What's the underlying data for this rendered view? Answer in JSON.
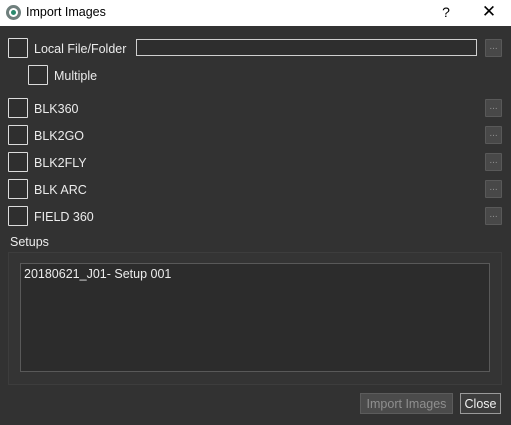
{
  "window": {
    "title": "Import Images",
    "help_glyph": "?",
    "close_glyph": "✕",
    "app_icon": "cyclone-logo-icon"
  },
  "local": {
    "label": "Local File/Folder",
    "path_value": "",
    "browse_label": "...",
    "multiple_label": "Multiple"
  },
  "devices": [
    {
      "label": "BLK360",
      "browse_label": "..."
    },
    {
      "label": "BLK2GO",
      "browse_label": "..."
    },
    {
      "label": "BLK2FLY",
      "browse_label": "..."
    },
    {
      "label": "BLK ARC",
      "browse_label": "..."
    },
    {
      "label": "FIELD 360",
      "browse_label": "..."
    }
  ],
  "setups": {
    "label": "Setups",
    "items": [
      "20180621_J01- Setup 001"
    ]
  },
  "buttons": {
    "import_label": "Import Images",
    "close_label": "Close"
  },
  "colors": {
    "background": "#323232",
    "titlebar": "#ffffff",
    "disabled_text": "#8f8f8f"
  }
}
